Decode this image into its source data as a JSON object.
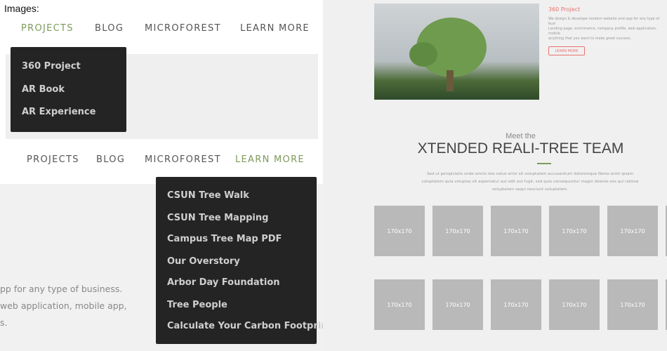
{
  "caption": "Images:",
  "nav1": {
    "items": [
      "PROJECTS",
      "BLOG",
      "MICROFOREST",
      "LEARN MORE"
    ],
    "active": "PROJECTS"
  },
  "dropdown1": [
    "360 Project",
    "AR Book",
    "AR Experience"
  ],
  "nav2": {
    "items": [
      "PROJECTS",
      "BLOG",
      "MICROFOREST",
      "LEARN MORE"
    ],
    "active": "LEARN MORE"
  },
  "dropdown2": [
    "CSUN Tree Walk",
    "CSUN Tree Mapping",
    "Campus Tree Map PDF",
    "Our Overstory",
    "Arbor Day Foundation",
    "Tree People",
    "Calculate Your Carbon Footprint"
  ],
  "left_text": [
    "pp for any type of business.",
    "web application, mobile app,",
    "s."
  ],
  "project": {
    "title": "360 Project",
    "desc": [
      "We design & develope modern website and app for any type of busi",
      "Landing page, ecommerce, company profile, web application, mobile",
      "anything that you want to make great success."
    ],
    "button": "LEARN MORE"
  },
  "team": {
    "pre": "Meet the",
    "title": "XTENDED REALI-TREE TEAM",
    "desc": [
      "Sed ut perspiciatis unde omnis iste natus error sit voluptatem accusantium doloremque Nemo enim ipsam",
      "voluptatem quia voluptas sit aspernatur aut odit aut fugit, sed quia consequuntur magni dolores eos qui ratione",
      "voluptatem sequi nesciunt voluptatem."
    ],
    "tile_label": "170x170"
  },
  "colors": {
    "accent_green": "#7d9a5a",
    "project_red": "#e8736f",
    "dropdown_bg": "#242424"
  }
}
